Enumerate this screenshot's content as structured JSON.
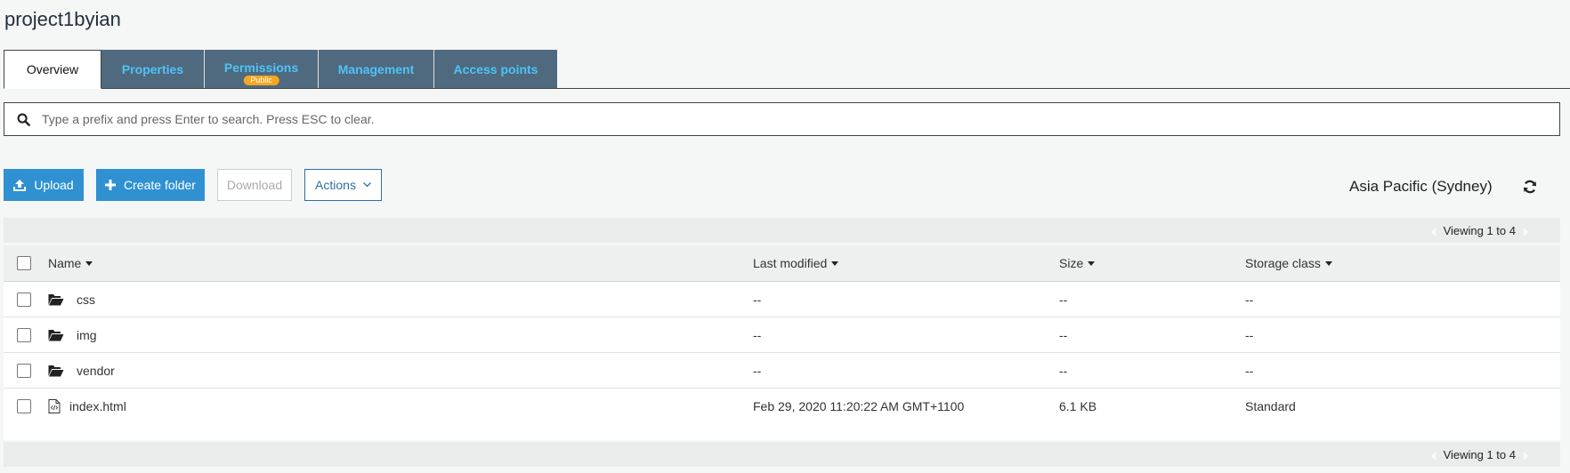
{
  "page": {
    "title": "project1byian"
  },
  "tabs": [
    {
      "label": "Overview",
      "active": true
    },
    {
      "label": "Properties"
    },
    {
      "label": "Permissions",
      "badge": "Public"
    },
    {
      "label": "Management"
    },
    {
      "label": "Access points"
    }
  ],
  "search": {
    "placeholder": "Type a prefix and press Enter to search. Press ESC to clear.",
    "value": ""
  },
  "toolbar": {
    "upload_label": "Upload",
    "create_folder_label": "Create folder",
    "download_label": "Download",
    "actions_label": "Actions",
    "region": "Asia Pacific (Sydney)"
  },
  "pagination": {
    "viewing_text": "Viewing 1 to 4"
  },
  "table": {
    "columns": [
      "Name",
      "Last modified",
      "Size",
      "Storage class"
    ],
    "rows": [
      {
        "name": "css",
        "type": "folder-icon",
        "last_modified": "--",
        "size": "--",
        "storage_class": "--"
      },
      {
        "name": "img",
        "type": "folder-icon",
        "last_modified": "--",
        "size": "--",
        "storage_class": "--"
      },
      {
        "name": "vendor",
        "type": "folder-icon",
        "last_modified": "--",
        "size": "--",
        "storage_class": "--"
      },
      {
        "name": "index.html",
        "type": "html-file-icon",
        "last_modified": "Feb 29, 2020 11:20:22 AM GMT+1100",
        "size": "6.1 KB",
        "storage_class": "Standard"
      }
    ]
  },
  "colors": {
    "tab_bg": "#4f6a7f",
    "tab_text": "#4fc3f7",
    "primary_button": "#2f91d2",
    "badge": "#f5a623"
  }
}
